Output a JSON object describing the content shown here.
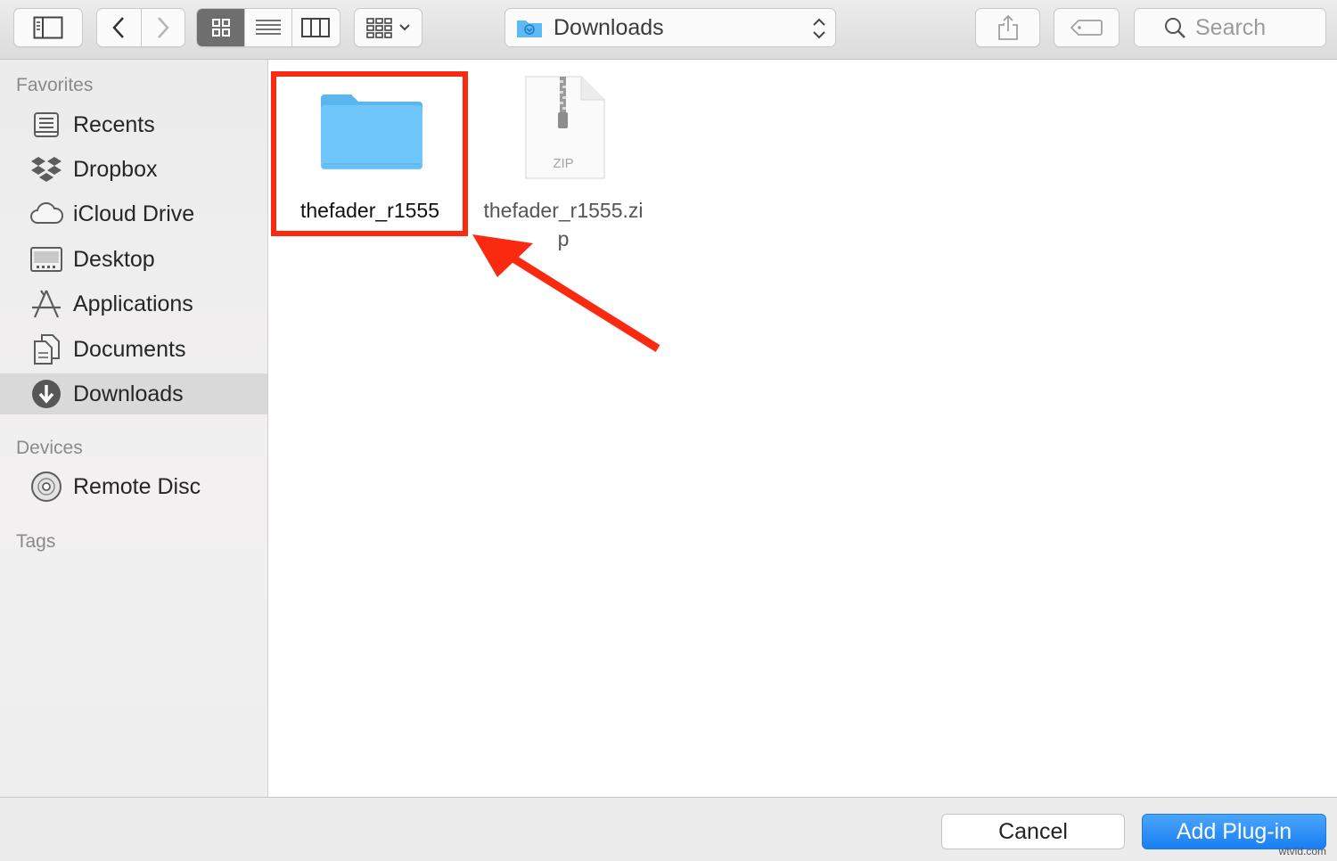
{
  "toolbar": {
    "path_label": "Downloads",
    "search_placeholder": "Search"
  },
  "sidebar": {
    "favorites_label": "Favorites",
    "favorites": [
      {
        "label": "Recents",
        "icon": "recents-icon"
      },
      {
        "label": "Dropbox",
        "icon": "dropbox-icon"
      },
      {
        "label": "iCloud Drive",
        "icon": "icloud-icon"
      },
      {
        "label": "Desktop",
        "icon": "desktop-icon"
      },
      {
        "label": "Applications",
        "icon": "applications-icon"
      },
      {
        "label": "Documents",
        "icon": "documents-icon"
      },
      {
        "label": "Downloads",
        "icon": "downloads-icon",
        "selected": true
      }
    ],
    "devices_label": "Devices",
    "devices": [
      {
        "label": "Remote Disc",
        "icon": "disc-icon"
      }
    ],
    "tags_label": "Tags"
  },
  "files": [
    {
      "name": "thefader_r1555",
      "kind": "folder",
      "icon": "folder-icon"
    },
    {
      "name_line1": "thefader_r1555.zi",
      "name_line2": "p",
      "kind": "zip",
      "icon": "zip-file-icon",
      "badge": "ZIP"
    }
  ],
  "buttons": {
    "cancel": "Cancel",
    "primary": "Add Plug-in"
  },
  "watermark": "wtvid.com",
  "colors": {
    "accent": "#1a7ef3",
    "highlight": "#fa2a10",
    "folder": "#68c5f8"
  }
}
